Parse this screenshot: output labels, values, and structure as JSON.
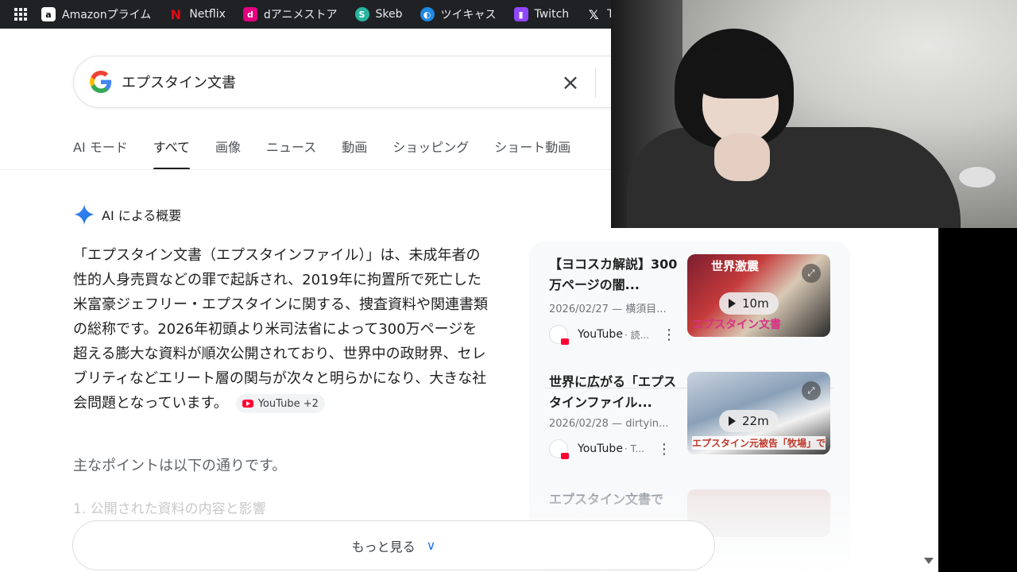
{
  "bookmarks": [
    {
      "label": "Amazonプライム",
      "icon": "amazon-icon",
      "color": "#ffffff"
    },
    {
      "label": "Netflix",
      "icon": "netflix-icon",
      "color": "#e50914"
    },
    {
      "label": "dアニメストア",
      "icon": "danime-icon",
      "color": "#e4007f"
    },
    {
      "label": "Skeb",
      "icon": "skeb-icon",
      "color": "#28b4a0"
    },
    {
      "label": "ツイキャス",
      "icon": "twitcasting-icon",
      "color": "#1e88e5"
    },
    {
      "label": "Twitch",
      "icon": "twitch-icon",
      "color": "#9146ff"
    },
    {
      "label": "Tw",
      "icon": "x-icon",
      "color": "#000000"
    }
  ],
  "search": {
    "query": "エプスタイン文書"
  },
  "tabs": [
    {
      "label": "AI モード",
      "active": false
    },
    {
      "label": "すべて",
      "active": true
    },
    {
      "label": "画像",
      "active": false
    },
    {
      "label": "ニュース",
      "active": false
    },
    {
      "label": "動画",
      "active": false
    },
    {
      "label": "ショッピング",
      "active": false
    },
    {
      "label": "ショート動画",
      "active": false
    }
  ],
  "ai_overview": {
    "heading": "AI による概要",
    "body": "「エプスタイン文書（エプスタインファイル）」は、未成年者の性的人身売買などの罪で起訴され、2019年に拘置所で死亡した米富豪ジェフリー・エプスタインに関する、捜査資料や関連書類の総称です。2026年初頭より米司法省によって300万ページを超える膨大な資料が順次公開されており、世界中の政財界、セレブリティなどエリート層の関与が次々と明らかになり、大きな社会問題となっています。",
    "source_chip": "YouTube +2",
    "points_intro": "主なポイントは以下の通りです。",
    "faded_item": "1. 公開された資料の内容と影響"
  },
  "more_button": "もっと見る",
  "videos": [
    {
      "title": "【ヨコスカ解説】300万ページの闇...",
      "date": "2026/02/27 — 横須目...",
      "source": "YouTube",
      "source_rest": "· 読...",
      "duration": "10m",
      "thumb_top": "世界激震",
      "thumb_caption": "エプスタイン文書"
    },
    {
      "title": "世界に広がる「エプスタインファイル...",
      "date": "2026/02/28 — dirtyin...",
      "source": "YouTube",
      "source_rest": "· T...",
      "duration": "22m",
      "thumb_top": "",
      "thumb_caption": "エプスタイン元被告「牧場」で何か"
    },
    {
      "title": "エプスタイン文書で",
      "date": "",
      "source": "",
      "source_rest": "",
      "duration": "",
      "thumb_top": "",
      "thumb_caption": ""
    }
  ],
  "colors": {
    "google_blue": "#4285f4",
    "google_red": "#ea4335",
    "google_yellow": "#fbbc05",
    "google_green": "#34a853",
    "link_blue": "#1a73e8"
  }
}
